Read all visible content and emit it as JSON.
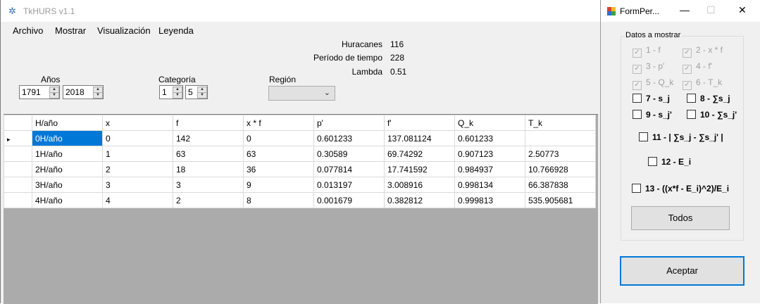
{
  "main_window": {
    "title": "TkHURS v1.1",
    "menu": [
      "Archivo",
      "Mostrar",
      "Visualización",
      "Leyenda"
    ],
    "stats": [
      {
        "label": "Huracanes",
        "value": "116"
      },
      {
        "label": "Período de tiempo",
        "value": "228"
      },
      {
        "label": "Lambda",
        "value": "0.51"
      }
    ],
    "years_label": "Años",
    "year_from": "1791",
    "year_to": "2018",
    "category_label": "Categoría",
    "category_from": "1",
    "category_to": "5",
    "region_label": "Región",
    "region_value": "",
    "grid": {
      "columns": [
        "H/año",
        "x",
        "f",
        "x * f",
        "p'",
        "f'",
        "Q_k",
        "T_k"
      ],
      "rows": [
        [
          "0H/año",
          "0",
          "142",
          "0",
          "0.601233",
          "137.081124",
          "0.601233",
          ""
        ],
        [
          "1H/año",
          "1",
          "63",
          "63",
          "0.30589",
          "69.74292",
          "0.907123",
          "2.50773"
        ],
        [
          "2H/año",
          "2",
          "18",
          "36",
          "0.077814",
          "17.741592",
          "0.984937",
          "10.766928"
        ],
        [
          "3H/año",
          "3",
          "3",
          "9",
          "0.013197",
          "3.008916",
          "0.998134",
          "66.387838"
        ],
        [
          "4H/año",
          "4",
          "2",
          "8",
          "0.001679",
          "0.382812",
          "0.999813",
          "535.905681"
        ]
      ],
      "current_row_marker": "▸"
    }
  },
  "form_per": {
    "title": "FormPer...",
    "group_title": "Datos a mostrar",
    "checkboxes": [
      {
        "label": "1 - f",
        "checked": true,
        "enabled": false
      },
      {
        "label": "2 - x * f",
        "checked": true,
        "enabled": false
      },
      {
        "label": "3 - p'",
        "checked": true,
        "enabled": false
      },
      {
        "label": "4 - f'",
        "checked": true,
        "enabled": false
      },
      {
        "label": "5 - Q_k",
        "checked": true,
        "enabled": false
      },
      {
        "label": "6 - T_k",
        "checked": true,
        "enabled": false
      },
      {
        "label": "7 -  s_j",
        "checked": false,
        "enabled": true
      },
      {
        "label": "8 - ∑s_j",
        "checked": false,
        "enabled": true
      },
      {
        "label": "9 - s_j'",
        "checked": false,
        "enabled": true
      },
      {
        "label": "10 - ∑s_j'",
        "checked": false,
        "enabled": true
      },
      {
        "label": "11 - | ∑s_j - ∑s_j' |",
        "checked": false,
        "enabled": true
      },
      {
        "label": "12 - E_i",
        "checked": false,
        "enabled": true
      },
      {
        "label": "13 - ((x*f - E_i)^2)/E_i",
        "checked": false,
        "enabled": true
      }
    ],
    "todos_label": "Todos",
    "aceptar_label": "Aceptar",
    "check_glyph": "✓"
  }
}
